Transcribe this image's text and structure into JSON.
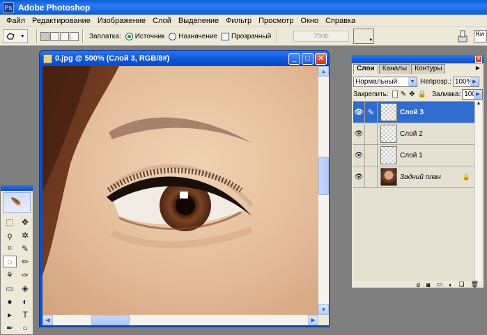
{
  "app": {
    "title": "Adobe Photoshop",
    "logo_text": "Ps"
  },
  "menu": [
    "Файл",
    "Редактирование",
    "Изображение",
    "Слой",
    "Выделение",
    "Фильтр",
    "Просмотр",
    "Окно",
    "Справка"
  ],
  "options": {
    "patch_label": "Заплатка:",
    "source_label": "Источник",
    "destination_label": "Назначение",
    "transparent_label": "Прозрачный",
    "pattern_button": "Узор",
    "right_field_text": "Ки",
    "source_selected": true,
    "transparent_checked": false
  },
  "document": {
    "title": "0.jpg @ 500% (Слой 3, RGB/8#)",
    "zoom": "500%",
    "min_glyph": "_",
    "max_glyph": "□",
    "close_glyph": "✕"
  },
  "layers_panel": {
    "tabs": [
      "Слои",
      "Каналы",
      "Контуры"
    ],
    "active_tab": "Слои",
    "blend_mode": "Нормальный",
    "opacity_label": "Непрозр.:",
    "opacity_value": "100%",
    "lock_label": "Закрепить:",
    "fill_label": "Заливка:",
    "fill_value": "100%",
    "layers": [
      {
        "name": "Слой 3",
        "selected": true,
        "visible": true,
        "thumb": "transparent"
      },
      {
        "name": "Слой 2",
        "selected": false,
        "visible": true,
        "thumb": "transparent"
      },
      {
        "name": "Слой 1",
        "selected": false,
        "visible": true,
        "thumb": "transparent"
      },
      {
        "name": "Задний план",
        "selected": false,
        "visible": true,
        "thumb": "photo",
        "locked": true
      }
    ]
  },
  "colors": {
    "title_bar": "#0a5ed6",
    "selected_layer": "#2f6ccd",
    "panel_bg": "#ece9d8",
    "workspace_bg": "#7f7f7f"
  },
  "icons": {
    "tool_preset": "patch-tool-icon",
    "tools": [
      "marquee-icon",
      "move-icon",
      "lasso-icon",
      "magic-wand-icon",
      "crop-icon",
      "slice-icon",
      "patch-icon",
      "brush-icon",
      "stamp-icon",
      "history-brush-icon",
      "eraser-icon",
      "bucket-icon",
      "blur-icon",
      "dodge-icon",
      "path-select-icon",
      "type-icon",
      "pen-icon",
      "shape-icon",
      "notes-icon",
      "eyedropper-icon"
    ],
    "tool_glyphs": [
      "⬚",
      "✥",
      "ϙ",
      "✲",
      "⌗",
      "✎",
      "◌",
      "✏",
      "⚘",
      "✑",
      "▭",
      "◈",
      "●",
      "◐",
      "▸",
      "T",
      "✒",
      "○",
      "▤",
      "✐"
    ]
  }
}
